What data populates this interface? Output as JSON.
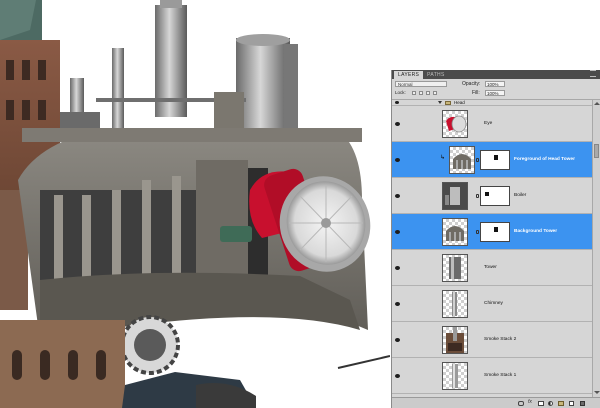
{
  "canvas": {
    "description_icon": "collage-canvas"
  },
  "layers_panel": {
    "tabs": [
      {
        "label": "LAYERS",
        "active": true
      },
      {
        "label": "PATHS",
        "active": false
      }
    ],
    "blend_mode": "Normal",
    "opacity_label": "Opacity:",
    "opacity_value": "100%",
    "lock_label": "Lock:",
    "fill_label": "Fill:",
    "fill_value": "100%",
    "group": {
      "label": "Head",
      "expanded": true
    },
    "layers": [
      {
        "name": "Eye",
        "selected": false,
        "has_mask": false,
        "clipped": false,
        "thumb": "eye-fan"
      },
      {
        "name": "Foreground of Head Tower",
        "selected": true,
        "has_mask": true,
        "clipped": true,
        "thumb": "dome"
      },
      {
        "name": "Boiler",
        "selected": false,
        "has_mask": true,
        "clipped": false,
        "thumb": "boiler"
      },
      {
        "name": "Background Tower",
        "selected": true,
        "has_mask": true,
        "clipped": false,
        "thumb": "dome"
      },
      {
        "name": "Tower",
        "selected": false,
        "has_mask": false,
        "clipped": false,
        "thumb": "tower"
      },
      {
        "name": "Chimney",
        "selected": false,
        "has_mask": false,
        "clipped": false,
        "thumb": "chimney"
      },
      {
        "name": "Smoke Stack 2",
        "selected": false,
        "has_mask": false,
        "clipped": false,
        "thumb": "smokestack"
      },
      {
        "name": "Smoke Stack 1",
        "selected": false,
        "has_mask": false,
        "clipped": false,
        "thumb": "smokestack"
      }
    ]
  },
  "colors": {
    "selection": "#3c93f0",
    "panel_bg": "#d6d6d6",
    "panel_header": "#4b4b4b",
    "fan_red": "#c8102e"
  }
}
